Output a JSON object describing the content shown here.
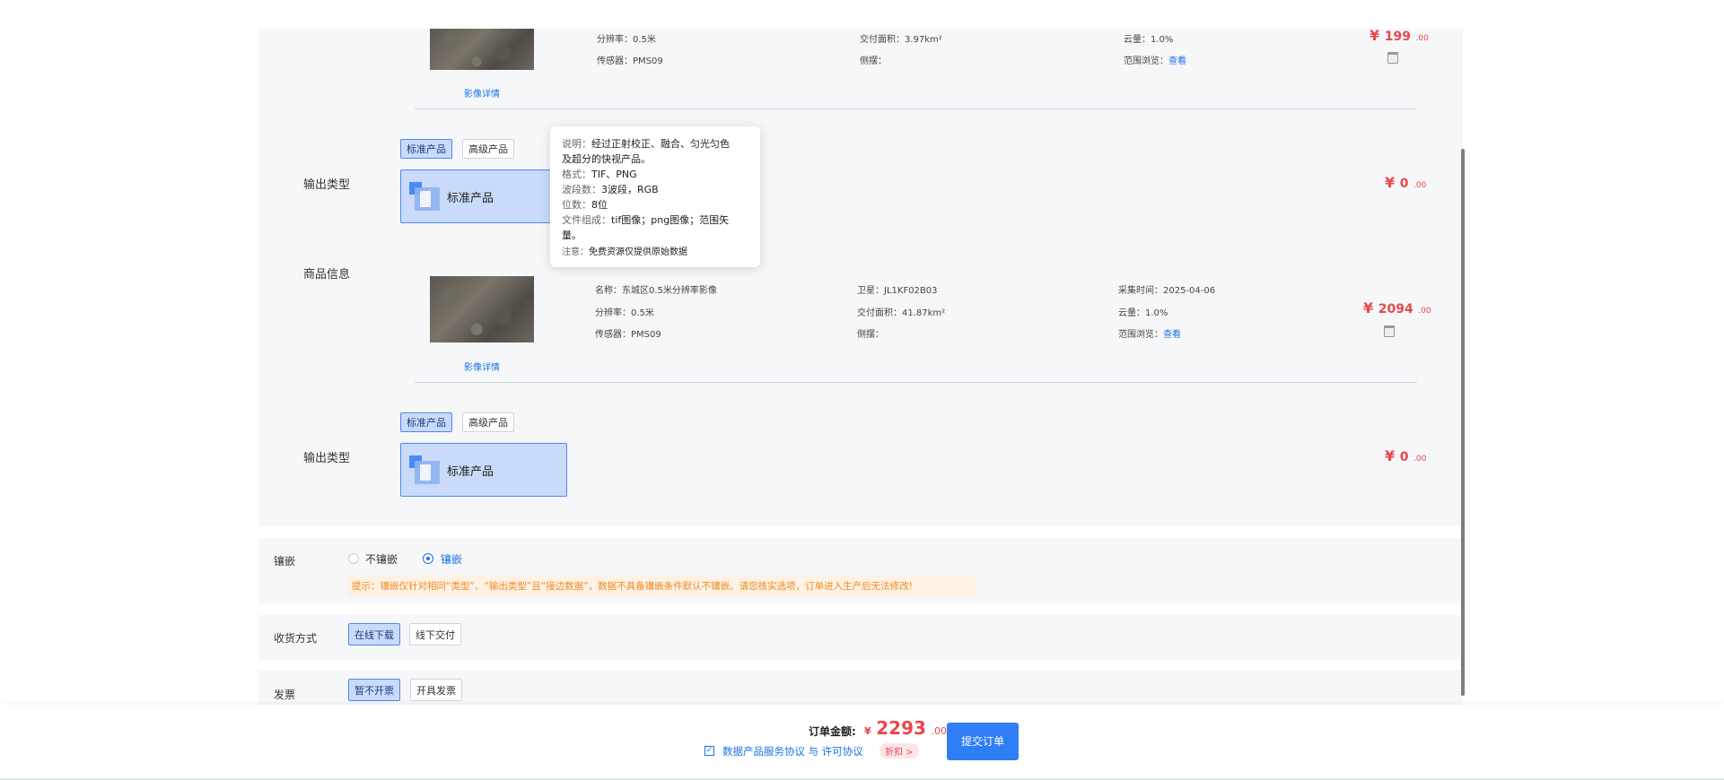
{
  "item1": {
    "resolution_label": "分辨率：",
    "resolution": "0.5米",
    "area_label": "交付面积：",
    "area": "3.97km²",
    "cloud_label": "云量：",
    "cloud": "1.0%",
    "sensor_label": "传感器：",
    "sensor": "PMS09",
    "side_label": "侧摆：",
    "range_label": "范围浏览：",
    "range_link": "查看",
    "price_symbol": "¥",
    "price_int": "199",
    "price_dec": ".00",
    "detail_link": "影像详情"
  },
  "output1": {
    "label": "输出类型",
    "tab_standard": "标准产品",
    "tab_advanced": "高级产品",
    "card_label": "标准产品",
    "price_symbol": "¥",
    "price_int": "0",
    "price_dec": ".00"
  },
  "tooltip": {
    "desc_key": "说明：",
    "desc_line1": "经过正射校正、融合、匀光匀色",
    "desc_line2": "及超分的快视产品。",
    "format_key": "格式：",
    "format": "TIF、PNG",
    "bands_key": "波段数：",
    "bands": "3波段，RGB",
    "bits_key": "位数：",
    "bits": "8位",
    "files_key": "文件组成：",
    "files_line1": "tif图像；png图像；范围矢",
    "files_line2": "量。",
    "note_key": "注意：",
    "note": "免费资源仅提供原始数据"
  },
  "goods_label": "商品信息",
  "item2": {
    "name_label": "名称：",
    "name": "东城区0.5米分辨率影像",
    "satellite_label": "卫星：",
    "satellite": "JL1KF02B03",
    "time_label": "采集时间：",
    "time": "2025-04-06",
    "resolution_label": "分辨率：",
    "resolution": "0.5米",
    "area_label": "交付面积：",
    "area": "41.87km²",
    "cloud_label": "云量：",
    "cloud": "1.0%",
    "sensor_label": "传感器：",
    "sensor": "PMS09",
    "side_label": "侧摆：",
    "range_label": "范围浏览：",
    "range_link": "查看",
    "price_symbol": "¥",
    "price_int": "2094",
    "price_dec": ".00",
    "detail_link": "影像详情"
  },
  "output2": {
    "label": "输出类型",
    "tab_standard": "标准产品",
    "tab_advanced": "高级产品",
    "card_label": "标准产品",
    "price_symbol": "¥",
    "price_int": "0",
    "price_dec": ".00"
  },
  "mosaic": {
    "label": "镶嵌",
    "option_no": "不镶嵌",
    "option_yes": "镶嵌",
    "selected": "镶嵌",
    "hint": "提示：镶嵌仅针对相同“类型”、“输出类型”且“接边数据”，数据不具备镶嵌条件默认不镶嵌。请您核实选项，订单进入生产后无法修改!"
  },
  "delivery": {
    "label": "收货方式",
    "online": "在线下载",
    "offline": "线下交付"
  },
  "invoice": {
    "label": "发票",
    "no_invoice": "暂不开票",
    "issue_invoice": "开具发票"
  },
  "footer": {
    "total_label": "订单金额:",
    "currency": "¥",
    "total_int": "2293",
    "total_dec": ".00",
    "agreement": "数据产品服务协议 与 许可协议",
    "discount": "折扣 >",
    "submit": "提交订单"
  },
  "colors": {
    "accent": "#2f7ef5",
    "price": "#e8474b",
    "selected_bg": "#c9dafb",
    "hint_text": "#f08a24"
  }
}
